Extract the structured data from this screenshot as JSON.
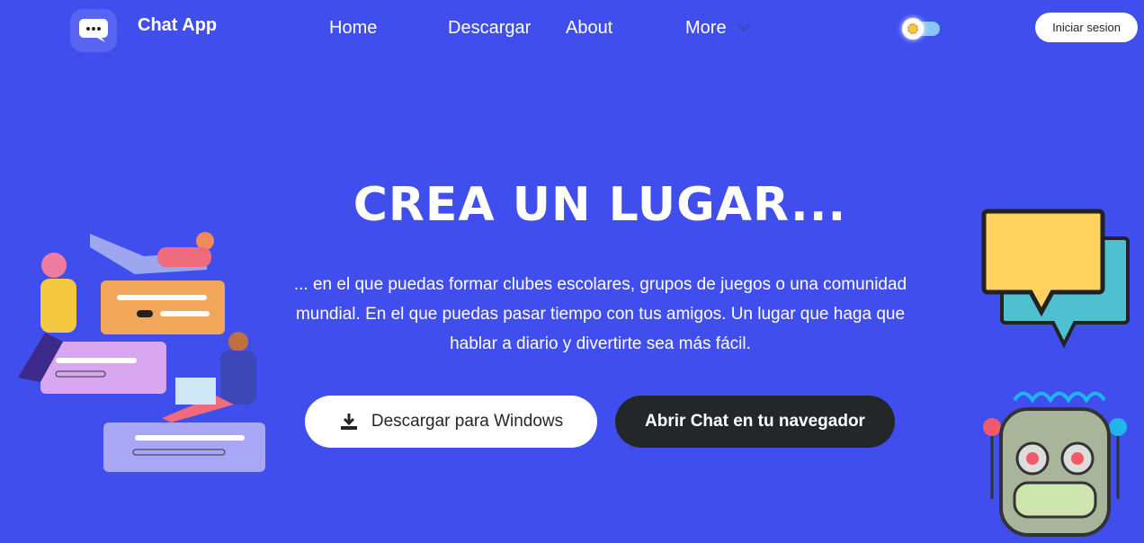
{
  "header": {
    "brand": "Chat App",
    "nav": [
      "Home",
      "Descargar",
      "About",
      "More"
    ],
    "login": "Iniciar sesion"
  },
  "hero": {
    "title": "CREA UN LUGAR...",
    "description": "... en el que puedas formar clubes escolares, grupos de juegos o una comunidad mundial. En el que puedas pasar tiempo con tus amigos. Un lugar que haga que hablar a diario y divertirte sea más fácil.",
    "download_label": "Descargar para Windows",
    "open_label": "Abrir Chat en tu navegador"
  },
  "colors": {
    "background": "#404eed",
    "dark": "#23272a"
  }
}
